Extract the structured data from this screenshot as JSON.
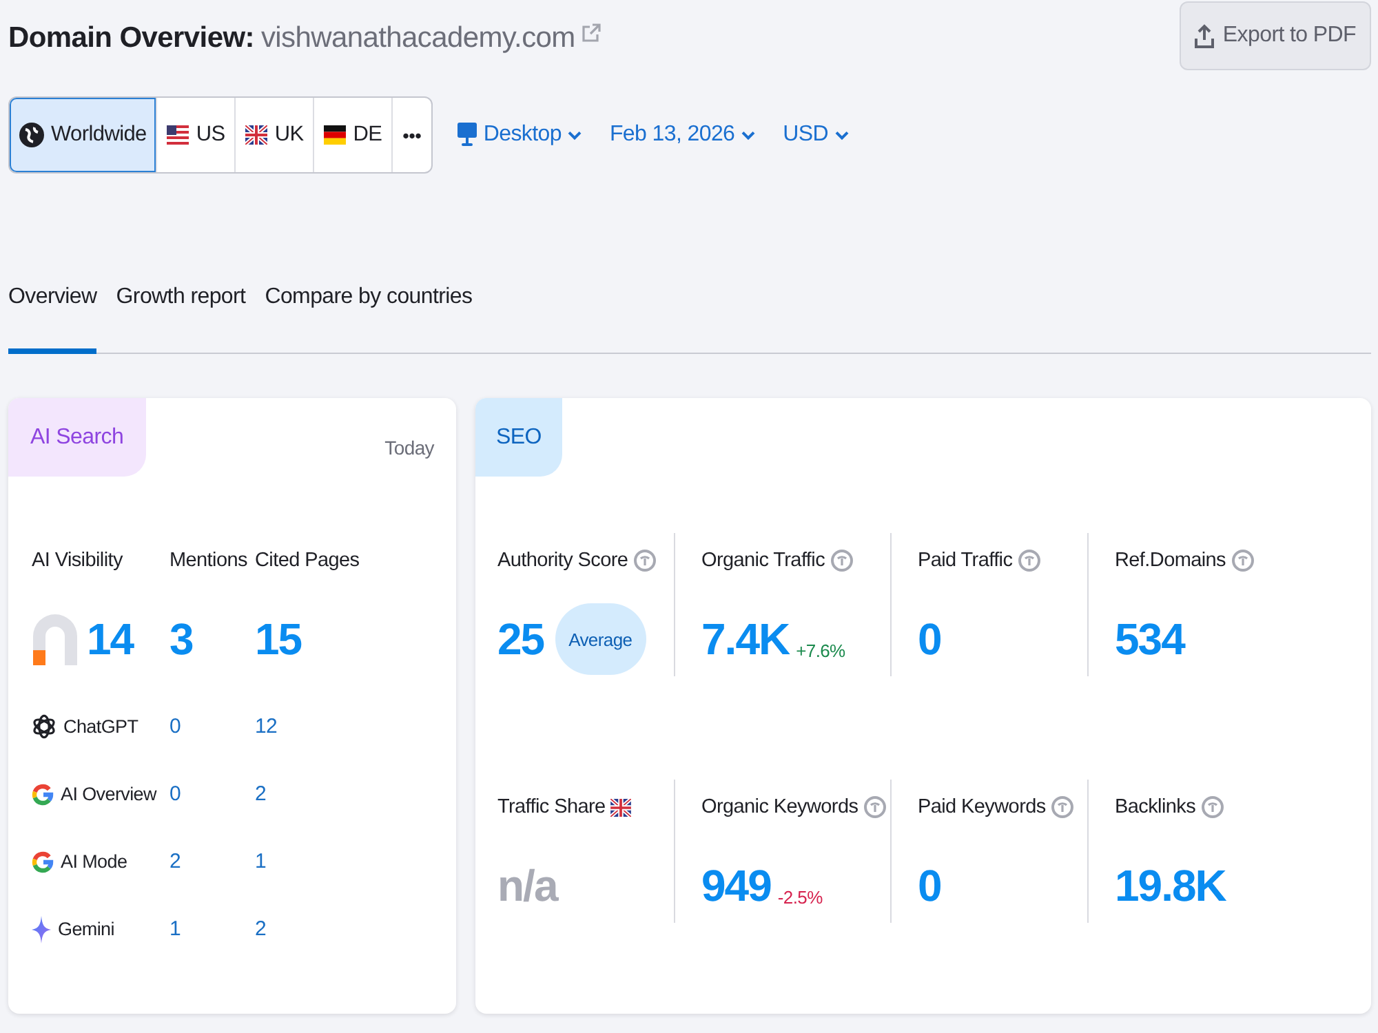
{
  "header": {
    "title": "Domain Overview:",
    "domain": "vishwanathacademy.com",
    "export_button": "Export to PDF"
  },
  "locations": [
    {
      "kind": "globe",
      "label": "Worldwide",
      "selected": true
    },
    {
      "kind": "us",
      "label": "US",
      "selected": false
    },
    {
      "kind": "uk",
      "label": "UK",
      "selected": false
    },
    {
      "kind": "de",
      "label": "DE",
      "selected": false
    },
    {
      "kind": "more",
      "label": "•••",
      "selected": false
    }
  ],
  "filters": [
    {
      "kind": "device",
      "label": "Desktop"
    },
    {
      "kind": "date",
      "label": "Feb 13, 2026"
    },
    {
      "kind": "currency",
      "label": "USD"
    }
  ],
  "tabs": [
    {
      "label": "Overview",
      "selected": true
    },
    {
      "label": "Growth report",
      "selected": false
    },
    {
      "label": "Compare by countries",
      "selected": false
    }
  ],
  "ai_search": {
    "tag": "AI Search",
    "period": "Today",
    "columns": [
      "AI Visibility",
      "Mentions",
      "Cited Pages"
    ],
    "totals": {
      "visibility": {
        "value": "14",
        "level": 0.14
      },
      "mentions": "3",
      "cited_pages": "15"
    },
    "platforms": [
      {
        "kind": "chatgpt",
        "name": "ChatGPT",
        "mentions": "0",
        "cited_pages": "12"
      },
      {
        "kind": "google",
        "name": "AI Overview",
        "mentions": "0",
        "cited_pages": "2"
      },
      {
        "kind": "google",
        "name": "AI Mode",
        "mentions": "2",
        "cited_pages": "1"
      },
      {
        "kind": "gemini",
        "name": "Gemini",
        "mentions": "1",
        "cited_pages": "2"
      }
    ]
  },
  "seo": {
    "tag": "SEO",
    "rows": [
      [
        {
          "label": "Authority Score",
          "kind": "info",
          "value": "25",
          "available": true,
          "badge": "Average"
        },
        {
          "label": "Organic Traffic",
          "kind": "info",
          "value": "7.4K",
          "available": true,
          "change": {
            "text": "+7.6%",
            "positive": true
          }
        },
        {
          "label": "Paid Traffic",
          "kind": "info",
          "value": "0",
          "available": true
        },
        {
          "label": "Ref.Domains",
          "kind": "info",
          "value": "534",
          "available": true
        }
      ],
      [
        {
          "label": "Traffic Share",
          "kind": "flag",
          "value": "n/a",
          "available": false
        },
        {
          "label": "Organic Keywords",
          "kind": "info",
          "value": "949",
          "available": true,
          "change": {
            "text": "-2.5%",
            "positive": false
          }
        },
        {
          "label": "Paid Keywords",
          "kind": "info",
          "value": "0",
          "available": true
        },
        {
          "label": "Backlinks",
          "kind": "info",
          "value": "19.8K",
          "available": true
        }
      ]
    ]
  }
}
